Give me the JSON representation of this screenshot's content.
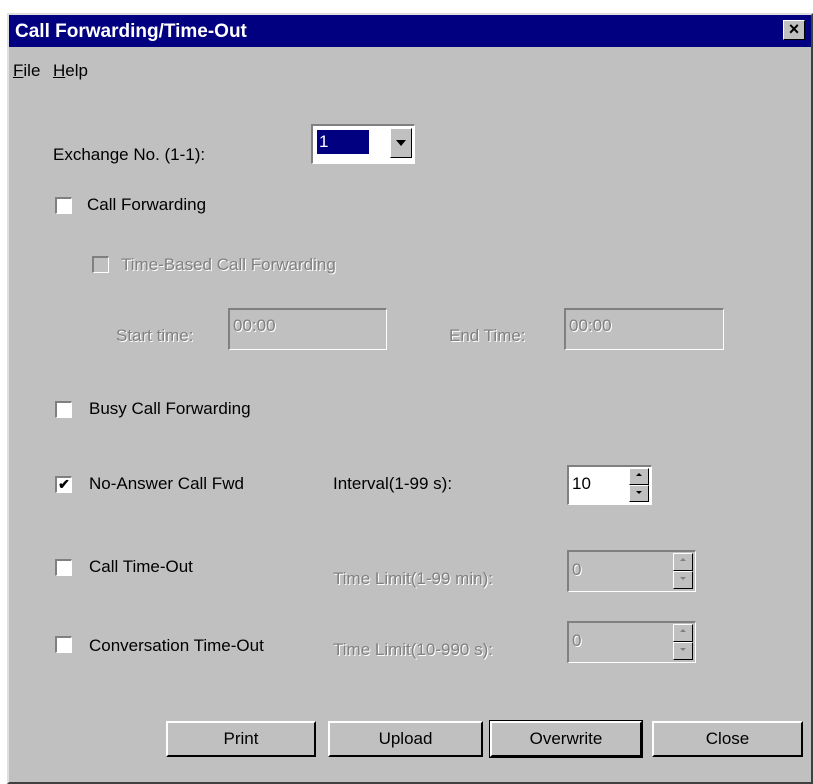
{
  "window": {
    "title": "Call Forwarding/Time-Out",
    "close_glyph": "×"
  },
  "menu": [
    {
      "label": "File",
      "mnemonic": "F"
    },
    {
      "label": "Help",
      "mnemonic": "H"
    }
  ],
  "exchange": {
    "label": "Exchange No. (1-1):",
    "value": "1"
  },
  "call_forwarding": {
    "label": "Call Forwarding",
    "checked": false
  },
  "time_based": {
    "label": "Time-Based Call Forwarding",
    "checked": false,
    "enabled": false,
    "start_label": "Start time:",
    "start_value": "00:00",
    "end_label": "End Time:",
    "end_value": "00:00"
  },
  "busy_forwarding": {
    "label": "Busy Call Forwarding",
    "checked": false
  },
  "no_answer": {
    "label": "No-Answer Call Fwd",
    "checked": true,
    "check_glyph": "✔",
    "interval_label": "Interval(1-99 s):",
    "interval_value": "10"
  },
  "call_timeout": {
    "label": "Call Time-Out",
    "checked": false,
    "limit_label": "Time Limit(1-99 min):",
    "limit_value": "0"
  },
  "conversation_timeout": {
    "label": "Conversation Time-Out",
    "checked": false,
    "limit_label": "Time Limit(10-990 s):",
    "limit_value": "0"
  },
  "buttons": {
    "print": "Print",
    "upload": "Upload",
    "overwrite": "Overwrite",
    "close": "Close"
  },
  "colors": {
    "face": "#c0c0c0",
    "titlebar": "#000080",
    "disabled_text": "#808080"
  }
}
